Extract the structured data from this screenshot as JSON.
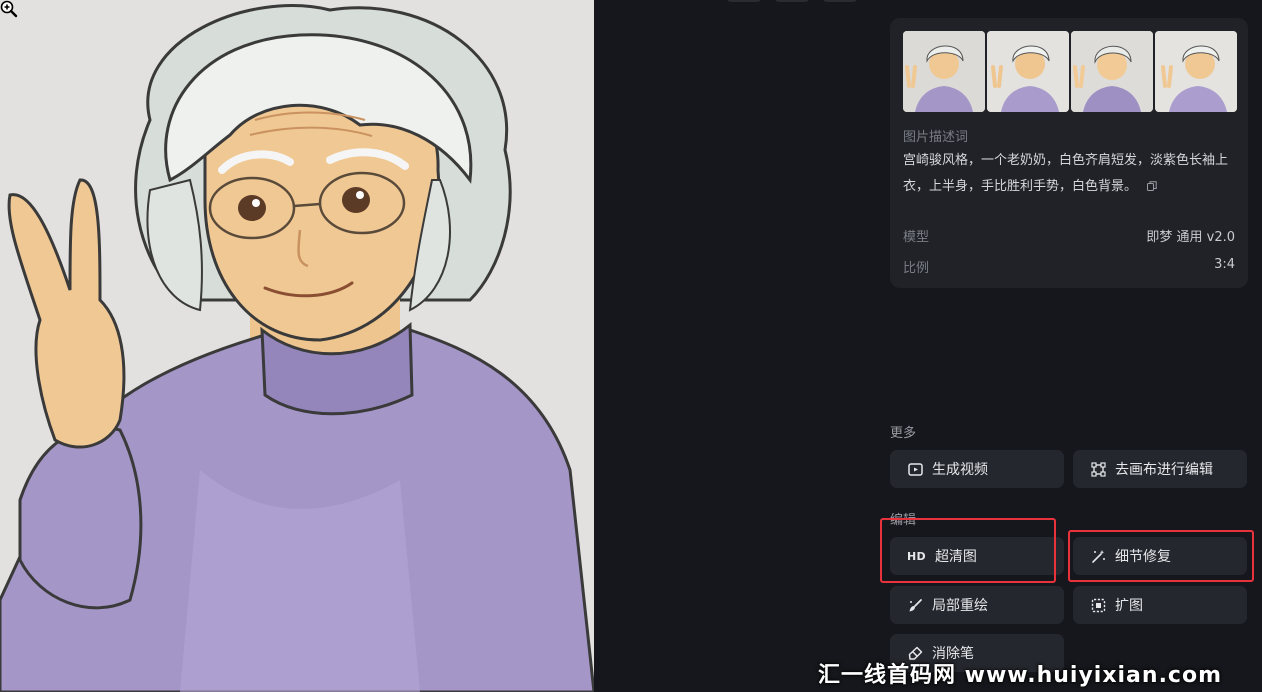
{
  "image_panel": {
    "alt": "Ghibli-style elderly woman with white hair in a lavender sweater making a peace sign"
  },
  "info": {
    "description_label": "图片描述词",
    "description_text": "宫崎骏风格，一个老奶奶，白色齐肩短发，淡紫色长袖上衣，上半身，手比胜利手势，白色背景。",
    "model_label": "模型",
    "model_value": "即梦 通用 v2.0",
    "ratio_label": "比例",
    "ratio_value": "3:4"
  },
  "more": {
    "title": "更多",
    "generate_video": "生成视频",
    "canvas_edit": "去画布进行编辑"
  },
  "edit": {
    "title": "编辑",
    "hd_badge": "HD",
    "upscale": "超清图",
    "detail_fix": "细节修复",
    "inpaint": "局部重绘",
    "expand": "扩图",
    "eraser": "消除笔"
  },
  "watermark": "汇一线首码网 www.huiyixian.com",
  "colors": {
    "background": "#16171c",
    "card": "#202228",
    "button": "#25272e",
    "highlight": "#e8333d",
    "sweater": "#a596c8"
  }
}
